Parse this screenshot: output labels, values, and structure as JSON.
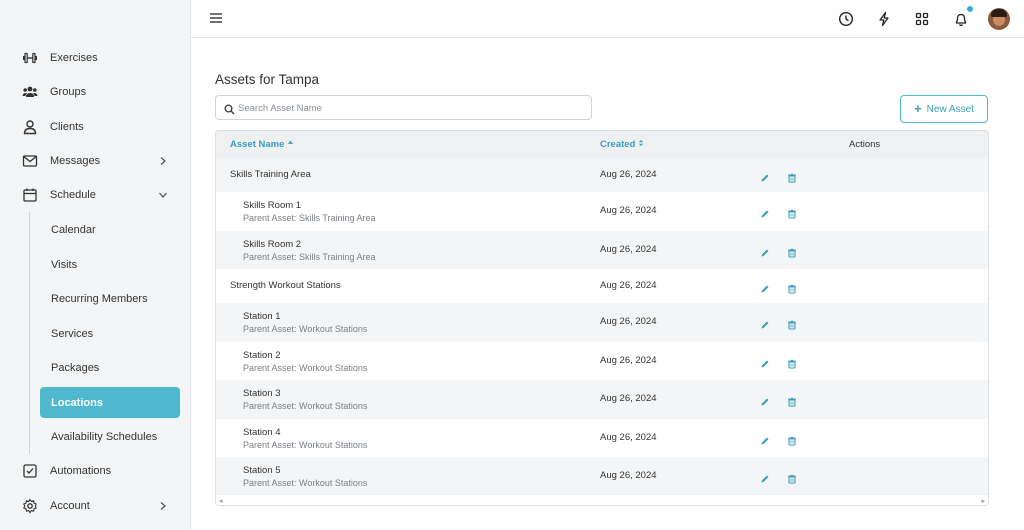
{
  "sidebar": {
    "items": [
      {
        "label": "Exercises",
        "icon": "dumbbell-icon"
      },
      {
        "label": "Groups",
        "icon": "group-icon"
      },
      {
        "label": "Clients",
        "icon": "user-icon"
      },
      {
        "label": "Messages",
        "icon": "envelope-icon",
        "chevron": "right"
      },
      {
        "label": "Schedule",
        "icon": "calendar-icon",
        "chevron": "down"
      }
    ],
    "schedule_sub": [
      "Calendar",
      "Visits",
      "Recurring Members",
      "Services",
      "Packages",
      "Locations",
      "Availability Schedules"
    ],
    "active_sub": "Locations",
    "bottom_items": [
      {
        "label": "Automations",
        "icon": "checkbox-icon"
      },
      {
        "label": "Account",
        "icon": "gear-icon",
        "chevron": "right"
      }
    ]
  },
  "topbar": {
    "icons": [
      "menu-icon",
      "clock-icon",
      "lightning-icon",
      "apps-grid-icon",
      "bell-icon",
      "avatar"
    ]
  },
  "main": {
    "title": "Assets for Tampa",
    "search_placeholder": "Search Asset Name",
    "search_value": "",
    "new_asset_label": "New Asset",
    "columns": {
      "name": "Asset Name",
      "created": "Created",
      "actions": "Actions"
    },
    "rows": [
      {
        "name": "Skills Training Area",
        "parent": "",
        "created": "Aug 26, 2024",
        "child": false
      },
      {
        "name": "Skills Room 1",
        "parent": "Parent Asset: Skills Training Area",
        "created": "Aug 26, 2024",
        "child": true
      },
      {
        "name": "Skills Room 2",
        "parent": "Parent Asset: Skills Training Area",
        "created": "Aug 26, 2024",
        "child": true
      },
      {
        "name": "Strength Workout Stations",
        "parent": "",
        "created": "Aug 26, 2024",
        "child": false
      },
      {
        "name": "Station 1",
        "parent": "Parent Asset: Workout Stations",
        "created": "Aug 26, 2024",
        "child": true
      },
      {
        "name": "Station 2",
        "parent": "Parent Asset: Workout Stations",
        "created": "Aug 26, 2024",
        "child": true
      },
      {
        "name": "Station 3",
        "parent": "Parent Asset: Workout Stations",
        "created": "Aug 26, 2024",
        "child": true
      },
      {
        "name": "Station 4",
        "parent": "Parent Asset: Workout Stations",
        "created": "Aug 26, 2024",
        "child": true
      },
      {
        "name": "Station 5",
        "parent": "Parent Asset: Workout Stations",
        "created": "Aug 26, 2024",
        "child": true
      }
    ]
  },
  "colors": {
    "accent": "#4fb8cf",
    "accent_text": "#3a9fbb",
    "notification": "#3aa9d6"
  }
}
